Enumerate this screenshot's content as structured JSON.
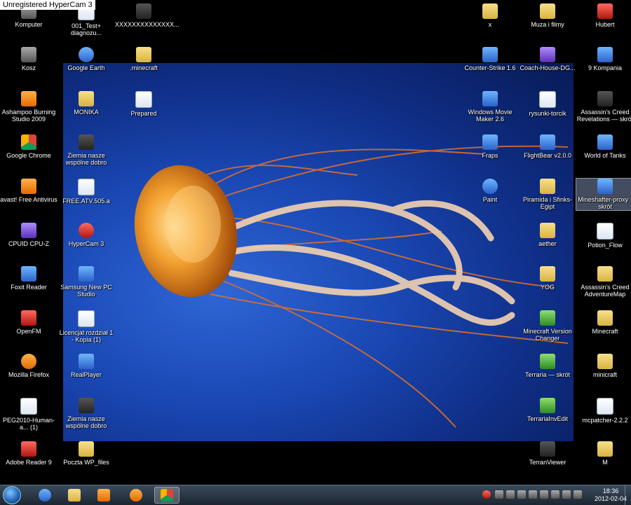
{
  "watermark": "Unregistered HyperCam 3",
  "desktop_icons": {
    "komputer": "Komputer",
    "test_diag": "001_Test+ diagnozu...",
    "xxx": "XXXXXXXXXXXXXX...",
    "x": "x",
    "muza": "Muza i filmy",
    "hubert": "Hubert",
    "kosz": "Kosz",
    "google_earth": "Google Earth",
    "minecraft_folder": ".minecraft",
    "counter_strike": "Counter-Strike 1.6",
    "coach": "Coach-House-DG...",
    "kompania": "9 Kompania",
    "ashampoo": "Ashampoo Burning Studio 2009",
    "monika": "MONIKA",
    "prepared": "Prepared",
    "movie_maker": "Windows Movie Maker 2.6",
    "rysunki": "rysunki-torcik",
    "ac_revelations": "Assassin's Creed Revelations — skrót",
    "chrome": "Google Chrome",
    "ziemia1": "Ziemia nasze wspólne dobro",
    "fraps": "Fraps",
    "flightbear": "FlightBear v2.0.0",
    "wot": "World of Tanks",
    "avast": "avast! Free Antivirus",
    "freeatv": "FREE.ATV.505.a",
    "paint": "Paint",
    "piramida": "Piramida i Sfinks-Egipt",
    "mineshafter": "Mineshafter-proxy - skrót",
    "cpuz": "CPUID CPU-Z",
    "hypercam": "HyperCam 3",
    "aether": "aether",
    "potion": "Potion_Flow",
    "foxit": "Foxit Reader",
    "samsung": "Samsung New PC Studio",
    "yog": "YOG",
    "ac_adventure": "Assassin's Creed AdventureMap",
    "openfm": "OpenFM",
    "licencjat": "Licencjat rozdział 1 - Kopia (1)",
    "mc_version": "Minecraft Version Changer",
    "minecraft2": "Minecraft",
    "firefox": "Mozilla Firefox",
    "realplayer": "RealPlayer",
    "terraria": "Terraria — skrót",
    "minicraft": "minicraft",
    "peg": "PEG2010-Human-a... (1)",
    "ziemia2": "Ziemia nasze wspólne dobro",
    "terraria_edit": "TerrariaInvEdit",
    "mcpatcher": "mcpatcher-2.2.2",
    "adobe": "Adobe Reader 9",
    "poczta": "Poczta WP_files",
    "terranviewer": "TerranViewer",
    "m": "M"
  },
  "clock": {
    "time": "18:36",
    "date": "2012-02-04"
  }
}
